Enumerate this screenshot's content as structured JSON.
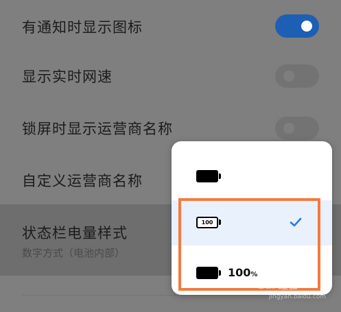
{
  "settings": {
    "rows": [
      {
        "label": "有通知时显示图标",
        "toggle": "on"
      },
      {
        "label": "显示实时网速",
        "toggle": "off"
      },
      {
        "label": "锁屏时显示运营商名称",
        "toggle": "off"
      },
      {
        "label": "自定义运营商名称"
      },
      {
        "label": "状态栏电量样式",
        "sublabel": "数字方式（电池内部）"
      }
    ]
  },
  "popup": {
    "options": [
      {
        "id": "icon",
        "battery_style": "solid-icon"
      },
      {
        "id": "inside",
        "battery_style": "number-inside",
        "battery_text": "100",
        "selected": true
      },
      {
        "id": "beside",
        "battery_style": "icon-with-percent",
        "percent_number": "100",
        "percent_sign": "%"
      }
    ]
  },
  "colors": {
    "accent": "#1d5fb4",
    "callout": "#f47a3e",
    "check": "#2b78e4"
  },
  "watermark": {
    "top": "Bai 经验",
    "bottom": "jingyan.baidu.com"
  }
}
